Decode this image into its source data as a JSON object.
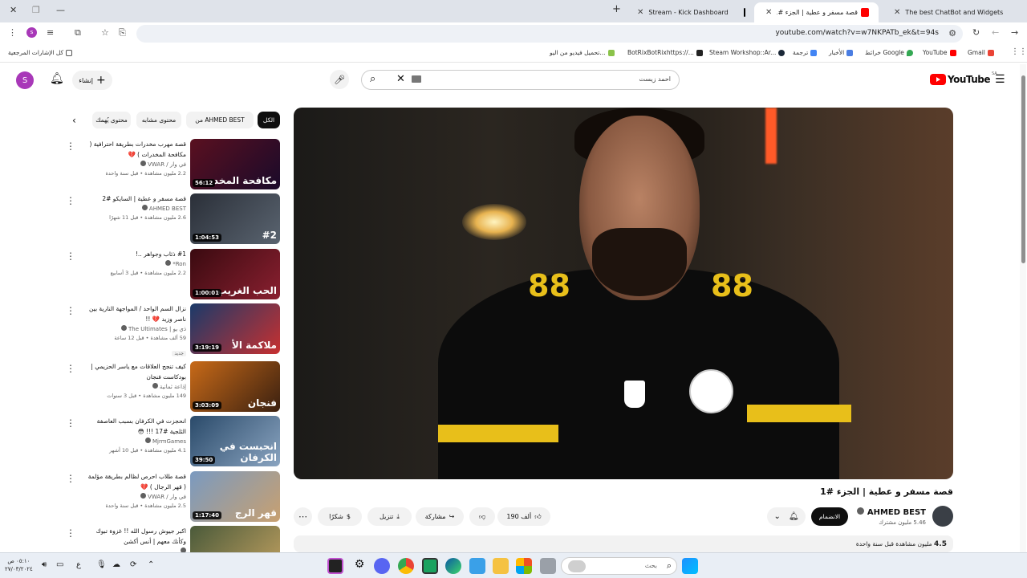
{
  "browser": {
    "tabs": [
      {
        "title": "The best ChatBot and Widgets",
        "icon": "widget-favicon-icon"
      },
      {
        "title": "قصة مسفر و عطية | الجزء #1 - ",
        "icon": "youtube-favicon-icon",
        "active": true
      },
      {
        "title": "",
        "icon": "kick-favicon-icon"
      },
      {
        "title": "Stream - Kick Dashboard",
        "icon": "kick-favicon-icon"
      }
    ],
    "new_tab": "+",
    "url": "youtube.com/watch?v=w7NKPATb_ek&t=94s",
    "profile_initial": "s",
    "bookmarks": [
      {
        "label": "Gmail",
        "color": "#ea4335"
      },
      {
        "label": "YouTube",
        "color": "#ff0000"
      },
      {
        "label": "خرائط Google",
        "color": "#34a853"
      },
      {
        "label": "الأخبار",
        "color": "#4a7de2"
      },
      {
        "label": "ترجمة",
        "color": "#4285f4"
      },
      {
        "label": "Steam Workshop::Ar...",
        "color": "#1b2838"
      },
      {
        "label": "BotRixBotRixhttps://...",
        "color": "#222222"
      },
      {
        "label": "تحميل فيديو من اليو...",
        "color": "#8bc34a"
      }
    ],
    "all_bookmarks": "كل الإشارات المرجعية"
  },
  "youtube": {
    "logo_text": "YouTube",
    "region": "SA",
    "search_query": "احمد زيست",
    "create_label": "إنشاء",
    "account_initial": "S"
  },
  "video": {
    "title": "قصة مسفر و عطية | الجزء #1",
    "channel": "AHMED BEST",
    "subscribers": "5.46 مليون مشترك",
    "join_label": "الانضمام",
    "likes": "190 ألف",
    "share_label": "مشاركة",
    "download_label": "تنزيل",
    "thanks_label": "شكرًا",
    "views": "4.5",
    "views_rest": "مليون مشاهدة قبل سنة واحدة"
  },
  "chips": [
    {
      "label": "الكل",
      "active": true
    },
    {
      "label": "من AHMED BEST"
    },
    {
      "label": "محتوى مشابه"
    },
    {
      "label": "محتوى يُهمك"
    }
  ],
  "recommendations": [
    {
      "title": "قصة مهرب مخدرات بطريقة احترافية ( مكافحة المخدرات ) 💔",
      "channel": "في وار / VWAR",
      "meta": "2.2 مليون مشاهدة • قبل سنة واحدة",
      "duration": "56:12",
      "thumb_text": "مكافحة المخد",
      "c1": "#5a1020",
      "c2": "#1a0a2a"
    },
    {
      "title": "قصة مسفر و عطية | السايكو #2",
      "channel": "AHMED BEST",
      "meta": "2.6 مليون مشاهدة • قبل 11 شهرًا",
      "duration": "1:04:53",
      "thumb_text": "#2",
      "c1": "#2a2f38",
      "c2": "#5a6470"
    },
    {
      "title": "#1 ذئاب وجواهر ..!",
      "channel": "Ron*",
      "meta": "2.2 مليون مشاهدة • قبل 3 أسابيع",
      "duration": "1:00:01",
      "thumb_text": "الحب الغريب",
      "c1": "#3a0a10",
      "c2": "#8a2030"
    },
    {
      "title": "نزال السم الواحد / المواجهة النارية بين ناصر وزيد 💔 !!",
      "channel": "ذي يو | The Ultimates",
      "meta": "59 ألف مشاهدة • قبل 12 ساعة",
      "badge": "جديد",
      "duration": "3:19:19",
      "thumb_text": "ملاكمة الأ",
      "c1": "#1a3a6a",
      "c2": "#c83030"
    },
    {
      "title": "كيف تنجح العلاقات مع ياسر الحزيمي | بودكاست فنجان",
      "channel": "إذاعة ثمانية",
      "meta": "149 مليون مشاهدة • قبل 3 سنوات",
      "duration": "3:03:09",
      "thumb_text": "فنجان",
      "c1": "#c86a18",
      "c2": "#3a2010"
    },
    {
      "title": "انحجزت في الكرفان بسبب العاصفة الثلجية #17 !!! 😳",
      "channel": "MjrmGames",
      "meta": "4.1 مليون مشاهدة • قبل 10 أشهر",
      "duration": "39:50",
      "thumb_text": "انحبست في الكرفان",
      "c1": "#2a4a6a",
      "c2": "#8aa4c0"
    },
    {
      "title": "قصة طلاب احرص لظالم بطريقة مؤلمة ( قهر الرجال ) 💔",
      "channel": "في وار / VWAR",
      "meta": "2.5 مليون مشاهدة • قبل سنة واحدة",
      "duration": "1:17:40",
      "thumb_text": "قهر الرج",
      "c1": "#7a9ac0",
      "c2": "#c8a070"
    },
    {
      "title": "اكبر جيوش رسول الله !! غزوة تبوك وكأنك معهم | أنس أكشن",
      "channel": "",
      "meta": "",
      "duration": "",
      "thumb_text": "",
      "c1": "#4a5a3a",
      "c2": "#c0a060"
    }
  ],
  "taskbar": {
    "search_label": "بحث",
    "time": "٠٥:١٠ ص",
    "date": "٢٧/٠٣/٢٠٢٤",
    "lang": "ع"
  }
}
